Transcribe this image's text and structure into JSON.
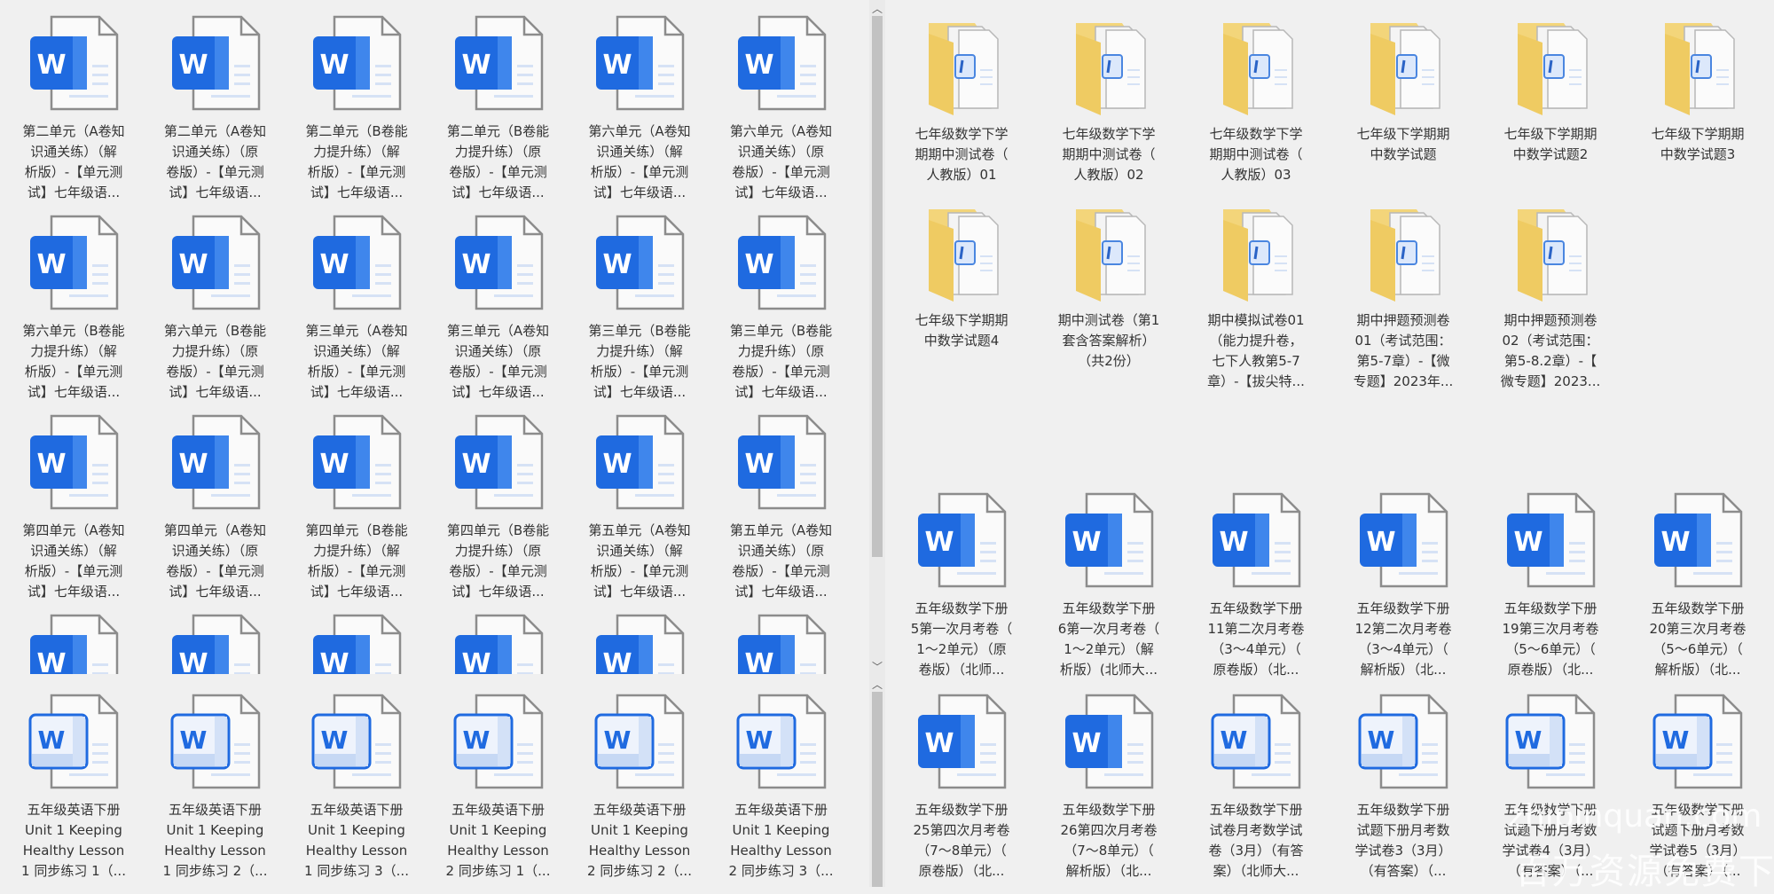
{
  "colors": {
    "background": "#f0f0f0",
    "word_blue": "#1f6ae0",
    "folder_yellow": "#f3d57a",
    "scrollbar_thumb": "#c2c2c2"
  },
  "panel_top_left": {
    "items": [
      {
        "icon": "word-filled",
        "label": "第二单元（A卷知\n识通关练）（解\n析版）-【单元测\n试】七年级语..."
      },
      {
        "icon": "word-filled",
        "label": "第二单元（A卷知\n识通关练）（原\n卷版）-【单元测\n试】七年级语..."
      },
      {
        "icon": "word-filled",
        "label": "第二单元（B卷能\n力提升练）（解\n析版）-【单元测\n试】七年级语..."
      },
      {
        "icon": "word-filled",
        "label": "第二单元（B卷能\n力提升练）（原\n卷版）-【单元测\n试】七年级语..."
      },
      {
        "icon": "word-filled",
        "label": "第六单元（A卷知\n识通关练）（解\n析版）-【单元测\n试】七年级语..."
      },
      {
        "icon": "word-filled",
        "label": "第六单元（A卷知\n识通关练）（原\n卷版）-【单元测\n试】七年级语..."
      },
      {
        "icon": "word-filled",
        "label": "第六单元（B卷能\n力提升练）（解\n析版）-【单元测\n试】七年级语..."
      },
      {
        "icon": "word-filled",
        "label": "第六单元（B卷能\n力提升练）（原\n卷版）-【单元测\n试】七年级语..."
      },
      {
        "icon": "word-filled",
        "label": "第三单元（A卷知\n识通关练）（解\n析版）-【单元测\n试】七年级语..."
      },
      {
        "icon": "word-filled",
        "label": "第三单元（A卷知\n识通关练）（原\n卷版）-【单元测\n试】七年级语..."
      },
      {
        "icon": "word-filled",
        "label": "第三单元（B卷能\n力提升练）（解\n析版）-【单元测\n试】七年级语..."
      },
      {
        "icon": "word-filled",
        "label": "第三单元（B卷能\n力提升练）（原\n卷版）-【单元测\n试】七年级语..."
      },
      {
        "icon": "word-filled",
        "label": "第四单元（A卷知\n识通关练）（解\n析版）-【单元测\n试】七年级语..."
      },
      {
        "icon": "word-filled",
        "label": "第四单元（A卷知\n识通关练）（原\n卷版）-【单元测\n试】七年级语..."
      },
      {
        "icon": "word-filled",
        "label": "第四单元（B卷能\n力提升练）（解\n析版）-【单元测\n试】七年级语..."
      },
      {
        "icon": "word-filled",
        "label": "第四单元（B卷能\n力提升练）（原\n卷版）-【单元测\n试】七年级语..."
      },
      {
        "icon": "word-filled",
        "label": "第五单元（A卷知\n识通关练）（解\n析版）-【单元测\n试】七年级语..."
      },
      {
        "icon": "word-filled",
        "label": "第五单元（A卷知\n识通关练）（原\n卷版）-【单元测\n试】七年级语..."
      },
      {
        "icon": "word-filled",
        "label": ""
      },
      {
        "icon": "word-filled",
        "label": ""
      },
      {
        "icon": "word-filled",
        "label": ""
      },
      {
        "icon": "word-filled",
        "label": ""
      },
      {
        "icon": "word-filled",
        "label": ""
      },
      {
        "icon": "word-filled",
        "label": ""
      }
    ]
  },
  "panel_bottom_left": {
    "items": [
      {
        "icon": "word-outline",
        "label": "五年级英语下册\nUnit 1 Keeping\nHealthy Lesson\n1 同步练习 1（..."
      },
      {
        "icon": "word-outline",
        "label": "五年级英语下册\nUnit 1 Keeping\nHealthy Lesson\n1 同步练习 2（..."
      },
      {
        "icon": "word-outline",
        "label": "五年级英语下册\nUnit 1 Keeping\nHealthy Lesson\n1 同步练习 3（..."
      },
      {
        "icon": "word-outline",
        "label": "五年级英语下册\nUnit 1 Keeping\nHealthy Lesson\n2 同步练习 1（..."
      },
      {
        "icon": "word-outline",
        "label": "五年级英语下册\nUnit 1 Keeping\nHealthy Lesson\n2 同步练习 2（..."
      },
      {
        "icon": "word-outline",
        "label": "五年级英语下册\nUnit 1 Keeping\nHealthy Lesson\n2 同步练习 3（..."
      }
    ]
  },
  "panel_top_right": {
    "folders_row1": [
      {
        "icon": "folder",
        "label": "七年级数学下学\n期期中测试卷（\n人教版）01"
      },
      {
        "icon": "folder",
        "label": "七年级数学下学\n期期中测试卷（\n人教版）02"
      },
      {
        "icon": "folder",
        "label": "七年级数学下学\n期期中测试卷（\n人教版）03"
      },
      {
        "icon": "folder",
        "label": "七年级下学期期\n中数学试题"
      },
      {
        "icon": "folder",
        "label": "七年级下学期期\n中数学试题2"
      },
      {
        "icon": "folder",
        "label": "七年级下学期期\n中数学试题3"
      }
    ],
    "folders_row2": [
      {
        "icon": "folder",
        "label": "七年级下学期期\n中数学试题4"
      },
      {
        "icon": "folder",
        "label": "期中测试卷（第1\n套含答案解析）\n（共2份）"
      },
      {
        "icon": "folder",
        "label": "期中模拟试卷01\n（能力提升卷，\n七下人教第5-7\n章）-【拔尖特..."
      },
      {
        "icon": "folder",
        "label": "期中押题预测卷\n01（考试范围：\n第5-7章）-【微\n专题】2023年..."
      },
      {
        "icon": "folder",
        "label": "期中押题预测卷\n02（考试范围：\n第5-8.2章）-【\n微专题】2023..."
      }
    ],
    "files": [
      {
        "icon": "word-filled",
        "label": "五年级数学下册\n5第一次月考卷（\n1～2单元）（原\n卷版）（北师..."
      },
      {
        "icon": "word-filled",
        "label": "五年级数学下册\n6第一次月考卷（\n1～2单元）（解\n析版）(北师大..."
      },
      {
        "icon": "word-filled",
        "label": "五年级数学下册\n11第二次月考卷\n（3～4单元）（\n原卷版）（北..."
      },
      {
        "icon": "word-filled",
        "label": "五年级数学下册\n12第二次月考卷\n（3～4单元）（\n解析版）（北..."
      },
      {
        "icon": "word-filled",
        "label": "五年级数学下册\n19第三次月考卷\n（5～6单元）（\n原卷版）（北..."
      },
      {
        "icon": "word-filled",
        "label": "五年级数学下册\n20第三次月考卷\n（5～6单元）（\n解析版）（北..."
      }
    ]
  },
  "panel_bottom_right": {
    "items": [
      {
        "icon": "word-filled",
        "label": "五年级数学下册\n25第四次月考卷\n（7～8单元）（\n原卷版）（北..."
      },
      {
        "icon": "word-filled",
        "label": "五年级数学下册\n26第四次月考卷\n（7～8单元）（\n解析版）（北..."
      },
      {
        "icon": "word-outline",
        "label": "五年级数学下册\n试卷月考数学试\n卷（3月）（有答\n案）（北师大..."
      },
      {
        "icon": "word-outline",
        "label": "五年级数学下册\n试题下册月考数\n学试卷3（3月）\n（有答案）（..."
      },
      {
        "icon": "word-outline",
        "label": "五年级数学下册\n试题下册月考数\n学试卷4（3月）\n（有答案）（..."
      },
      {
        "icon": "word-outline",
        "label": "五年级数学下册\n试题下册月考数\n学试卷5（3月）\n（有答案）（..."
      }
    ]
  },
  "scrollbar": {
    "up_arrow": "︿",
    "down_arrow": "﹀"
  },
  "watermark": {
    "line1": "zhipinquan.com",
    "line2": "百万资源免费下载"
  }
}
